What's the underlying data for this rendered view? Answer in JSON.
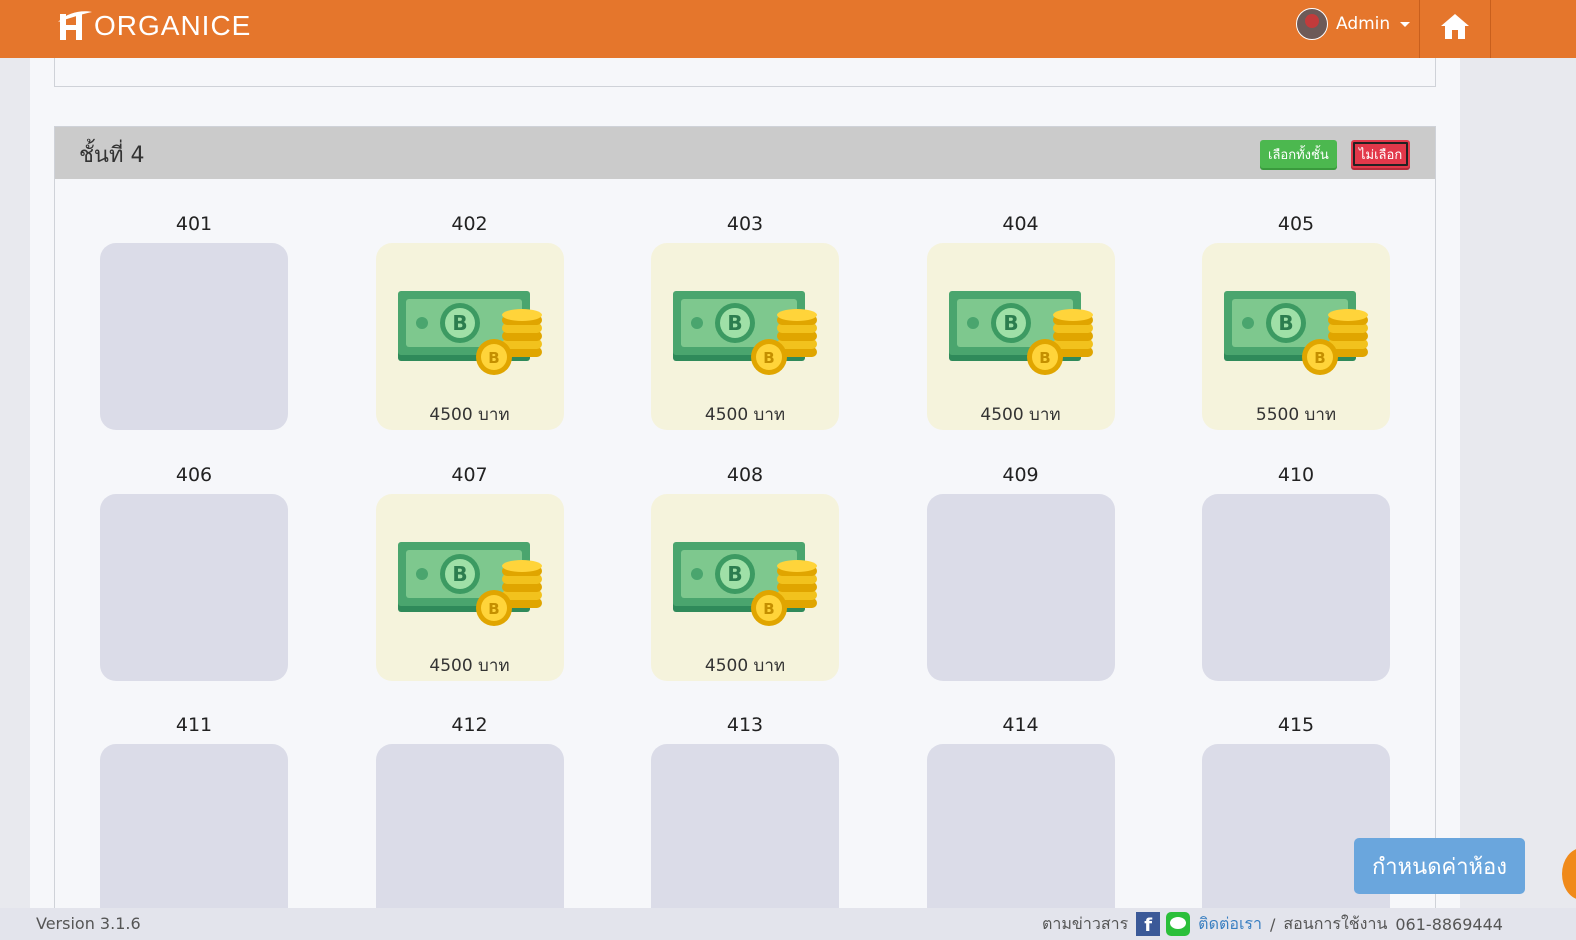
{
  "brand": {
    "name": "ORGANICE"
  },
  "header": {
    "user_name": "Admin"
  },
  "floor": {
    "title": "ชั้นที่ 4",
    "select_all_label": "เลือกทั้งชั้น",
    "deselect_label": "ไม่เลือก"
  },
  "rooms": [
    {
      "number": "401",
      "price": ""
    },
    {
      "number": "402",
      "price": "4500 บาท"
    },
    {
      "number": "403",
      "price": "4500 บาท"
    },
    {
      "number": "404",
      "price": "4500 บาท"
    },
    {
      "number": "405",
      "price": "5500 บาท"
    },
    {
      "number": "406",
      "price": ""
    },
    {
      "number": "407",
      "price": "4500 บาท"
    },
    {
      "number": "408",
      "price": "4500 บาท"
    },
    {
      "number": "409",
      "price": ""
    },
    {
      "number": "410",
      "price": ""
    },
    {
      "number": "411",
      "price": ""
    },
    {
      "number": "412",
      "price": ""
    },
    {
      "number": "413",
      "price": ""
    },
    {
      "number": "414",
      "price": ""
    },
    {
      "number": "415",
      "price": ""
    }
  ],
  "actions": {
    "set_price_label": "กำหนดค่าห้อง"
  },
  "footer": {
    "version": "Version 3.1.6",
    "follow_label": "ตามข่าวสาร",
    "contact_label": "ติดต่อเรา",
    "separator": "/",
    "manual_label": "สอนการใช้งาน",
    "phone": "061-8869444"
  }
}
